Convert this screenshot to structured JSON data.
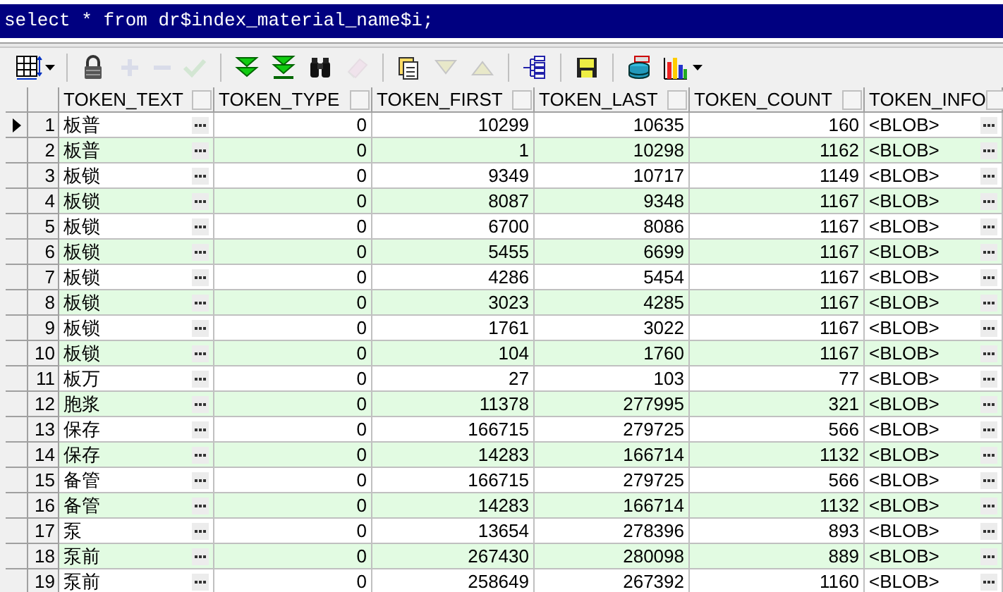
{
  "sql_editor": {
    "text": "select * from dr$index_material_name$i;"
  },
  "toolbar": [
    [
      {
        "kind": "grid",
        "dropdown": true,
        "disabled": false
      }
    ],
    [
      {
        "kind": "lock",
        "dropdown": false,
        "disabled": false
      },
      {
        "kind": "plus",
        "dropdown": false,
        "disabled": true
      },
      {
        "kind": "minus",
        "dropdown": false,
        "disabled": true
      },
      {
        "kind": "check",
        "dropdown": false,
        "disabled": true
      }
    ],
    [
      {
        "kind": "fetchnext",
        "dropdown": false,
        "disabled": false
      },
      {
        "kind": "fetchall",
        "dropdown": false,
        "disabled": false
      },
      {
        "kind": "find",
        "dropdown": false,
        "disabled": false
      },
      {
        "kind": "eraser",
        "dropdown": false,
        "disabled": true
      }
    ],
    [
      {
        "kind": "docs",
        "dropdown": false,
        "disabled": false
      },
      {
        "kind": "down",
        "dropdown": false,
        "disabled": true
      },
      {
        "kind": "up",
        "dropdown": false,
        "disabled": true
      }
    ],
    [
      {
        "kind": "tree",
        "dropdown": false,
        "disabled": false
      }
    ],
    [
      {
        "kind": "save",
        "dropdown": false,
        "disabled": false
      }
    ],
    [
      {
        "kind": "db",
        "dropdown": false,
        "disabled": false
      },
      {
        "kind": "chart",
        "dropdown": true,
        "disabled": false
      }
    ]
  ],
  "table": {
    "columns": [
      "TOKEN_TEXT",
      "TOKEN_TYPE",
      "TOKEN_FIRST",
      "TOKEN_LAST",
      "TOKEN_COUNT",
      "TOKEN_INFO"
    ],
    "rows": [
      {
        "num": "1",
        "current": true,
        "cells": [
          "板普",
          "0",
          "10299",
          "10635",
          "160",
          "<BLOB>"
        ]
      },
      {
        "num": "2",
        "current": false,
        "cells": [
          "板普",
          "0",
          "1",
          "10298",
          "1162",
          "<BLOB>"
        ]
      },
      {
        "num": "3",
        "current": false,
        "cells": [
          "板锁",
          "0",
          "9349",
          "10717",
          "1149",
          "<BLOB>"
        ]
      },
      {
        "num": "4",
        "current": false,
        "cells": [
          "板锁",
          "0",
          "8087",
          "9348",
          "1167",
          "<BLOB>"
        ]
      },
      {
        "num": "5",
        "current": false,
        "cells": [
          "板锁",
          "0",
          "6700",
          "8086",
          "1167",
          "<BLOB>"
        ]
      },
      {
        "num": "6",
        "current": false,
        "cells": [
          "板锁",
          "0",
          "5455",
          "6699",
          "1167",
          "<BLOB>"
        ]
      },
      {
        "num": "7",
        "current": false,
        "cells": [
          "板锁",
          "0",
          "4286",
          "5454",
          "1167",
          "<BLOB>"
        ]
      },
      {
        "num": "8",
        "current": false,
        "cells": [
          "板锁",
          "0",
          "3023",
          "4285",
          "1167",
          "<BLOB>"
        ]
      },
      {
        "num": "9",
        "current": false,
        "cells": [
          "板锁",
          "0",
          "1761",
          "3022",
          "1167",
          "<BLOB>"
        ]
      },
      {
        "num": "10",
        "current": false,
        "cells": [
          "板锁",
          "0",
          "104",
          "1760",
          "1167",
          "<BLOB>"
        ]
      },
      {
        "num": "11",
        "current": false,
        "cells": [
          "板万",
          "0",
          "27",
          "103",
          "77",
          "<BLOB>"
        ]
      },
      {
        "num": "12",
        "current": false,
        "cells": [
          "胞浆",
          "0",
          "11378",
          "277995",
          "321",
          "<BLOB>"
        ]
      },
      {
        "num": "13",
        "current": false,
        "cells": [
          "保存",
          "0",
          "166715",
          "279725",
          "566",
          "<BLOB>"
        ]
      },
      {
        "num": "14",
        "current": false,
        "cells": [
          "保存",
          "0",
          "14283",
          "166714",
          "1132",
          "<BLOB>"
        ]
      },
      {
        "num": "15",
        "current": false,
        "cells": [
          "备管",
          "0",
          "166715",
          "279725",
          "566",
          "<BLOB>"
        ]
      },
      {
        "num": "16",
        "current": false,
        "cells": [
          "备管",
          "0",
          "14283",
          "166714",
          "1132",
          "<BLOB>"
        ]
      },
      {
        "num": "17",
        "current": false,
        "cells": [
          "泵",
          "0",
          "13654",
          "278396",
          "893",
          "<BLOB>"
        ]
      },
      {
        "num": "18",
        "current": false,
        "cells": [
          "泵前",
          "0",
          "267430",
          "280098",
          "889",
          "<BLOB>"
        ]
      },
      {
        "num": "19",
        "current": false,
        "cells": [
          "泵前",
          "0",
          "258649",
          "267392",
          "1160",
          "<BLOB>"
        ]
      }
    ]
  }
}
